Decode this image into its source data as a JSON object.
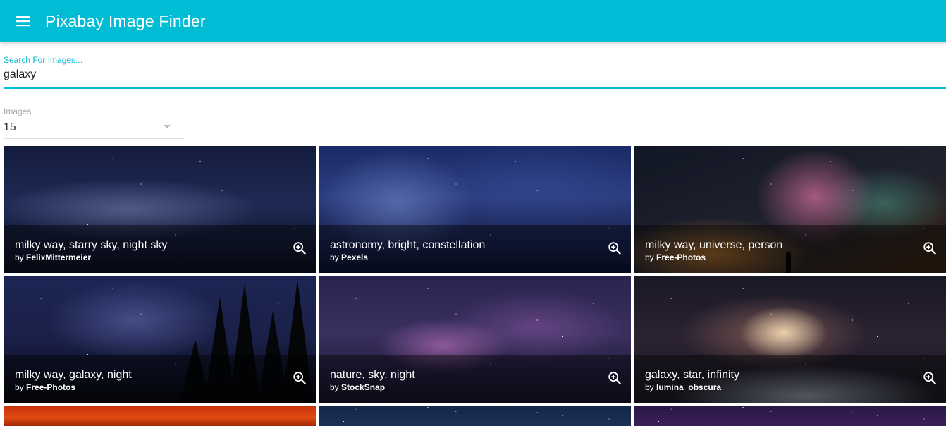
{
  "app": {
    "title": "Pixabay Image Finder"
  },
  "search": {
    "label": "Search For Images...",
    "value": "galaxy"
  },
  "amount": {
    "label": "Images",
    "value": "15"
  },
  "credit_prefix": "by",
  "images": [
    {
      "tags": "milky way, starry sky, night sky",
      "user": "FelixMittermeier"
    },
    {
      "tags": "astronomy, bright, constellation",
      "user": "Pexels"
    },
    {
      "tags": "milky way, universe, person",
      "user": "Free-Photos"
    },
    {
      "tags": "milky way, galaxy, night",
      "user": "Free-Photos"
    },
    {
      "tags": "nature, sky, night",
      "user": "StockSnap"
    },
    {
      "tags": "galaxy, star, infinity",
      "user": "lumina_obscura"
    }
  ],
  "colors": {
    "primary": "#00bcd4"
  },
  "icons": {
    "menu": "menu-icon",
    "zoom": "zoom-in-icon",
    "dropdown": "caret-down-icon"
  }
}
